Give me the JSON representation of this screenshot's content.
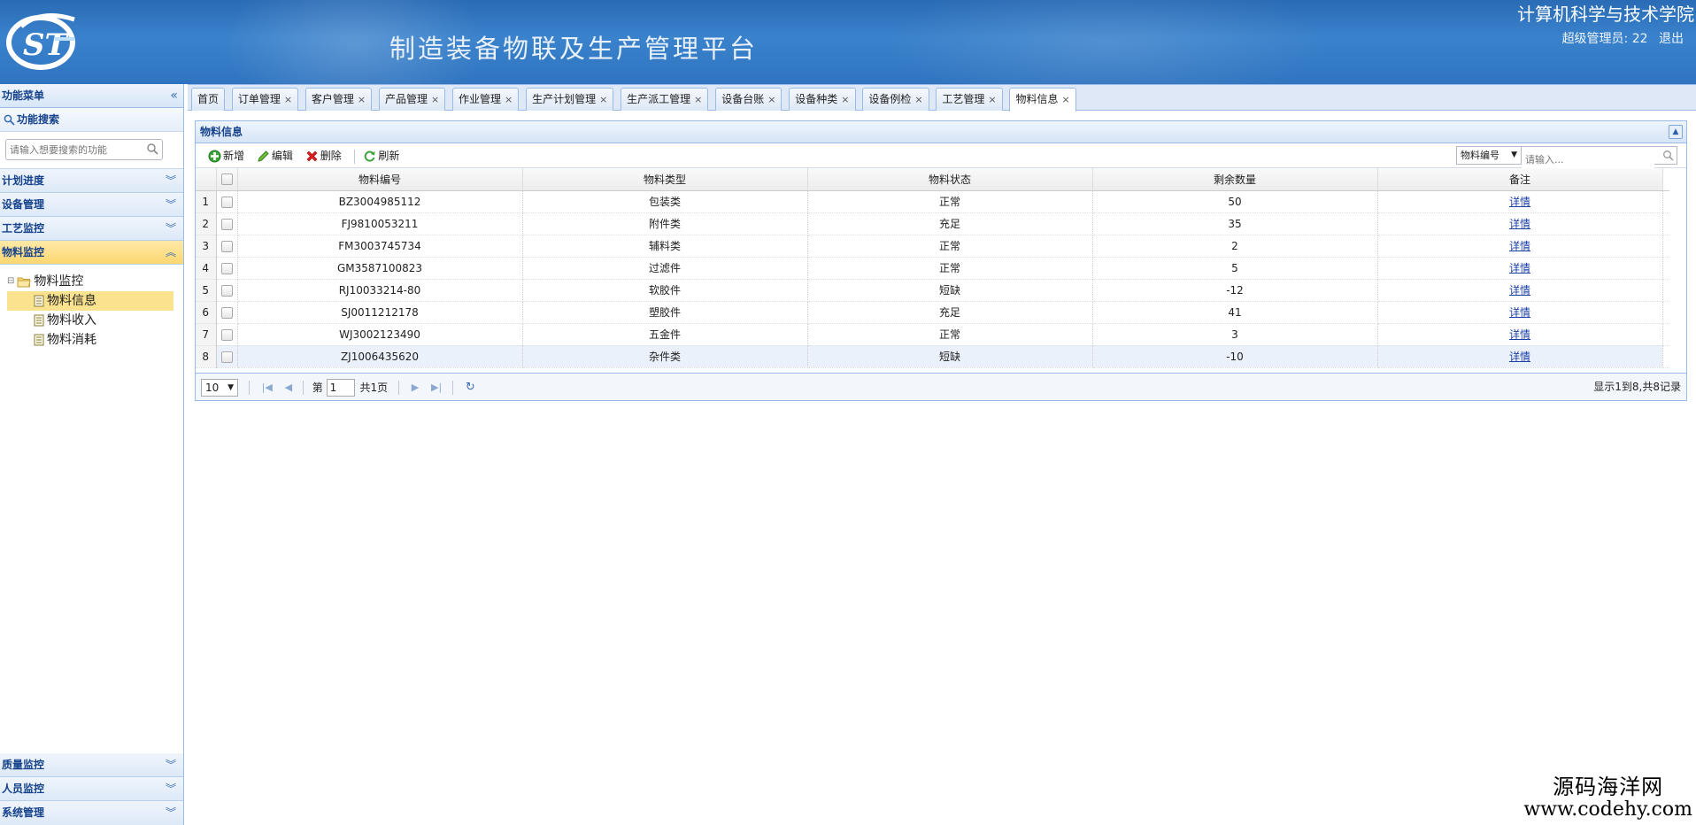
{
  "header": {
    "app_title": "制造装备物联及生产管理平台",
    "college": "计算机科学与技术学院",
    "user_label": "超级管理员: 22",
    "logout": "退出"
  },
  "sidebar": {
    "title": "功能菜单",
    "search_title": "功能搜索",
    "search_placeholder": "请输入想要搜索的功能",
    "sections": [
      "计划进度",
      "设备管理",
      "工艺监控",
      "物料监控"
    ],
    "tree": {
      "root": "物料监控",
      "children": [
        "物料信息",
        "物料收入",
        "物料消耗"
      ]
    },
    "bottom_sections": [
      "质量监控",
      "人员监控",
      "系统管理"
    ]
  },
  "tabs": [
    "首页",
    "订单管理",
    "客户管理",
    "产品管理",
    "作业管理",
    "生产计划管理",
    "生产派工管理",
    "设备台账",
    "设备种类",
    "设备例检",
    "工艺管理",
    "物料信息"
  ],
  "panel": {
    "title": "物料信息",
    "toolbar": {
      "add": "新增",
      "edit": "编辑",
      "delete": "删除",
      "refresh": "刷新"
    },
    "search_field": "物料编号",
    "search_placeholder": "请输入..."
  },
  "grid": {
    "columns": [
      "物料编号",
      "物料类型",
      "物料状态",
      "剩余数量",
      "备注"
    ],
    "rows": [
      {
        "n": "1",
        "code": "BZ3004985112",
        "type": "包装类",
        "status": "正常",
        "qty": "50",
        "note": "详情"
      },
      {
        "n": "2",
        "code": "FJ9810053211",
        "type": "附件类",
        "status": "充足",
        "qty": "35",
        "note": "详情"
      },
      {
        "n": "3",
        "code": "FM3003745734",
        "type": "辅料类",
        "status": "正常",
        "qty": "2",
        "note": "详情"
      },
      {
        "n": "4",
        "code": "GM3587100823",
        "type": "过滤件",
        "status": "正常",
        "qty": "5",
        "note": "详情"
      },
      {
        "n": "5",
        "code": "RJ10033214-80",
        "type": "软胶件",
        "status": "短缺",
        "qty": "-12",
        "note": "详情"
      },
      {
        "n": "6",
        "code": "SJ0011212178",
        "type": "塑胶件",
        "status": "充足",
        "qty": "41",
        "note": "详情"
      },
      {
        "n": "7",
        "code": "WJ3002123490",
        "type": "五金件",
        "status": "正常",
        "qty": "3",
        "note": "详情"
      },
      {
        "n": "8",
        "code": "ZJ1006435620",
        "type": "杂件类",
        "status": "短缺",
        "qty": "-10",
        "note": "详情"
      }
    ]
  },
  "pager": {
    "page_size": "10",
    "page_prefix": "第",
    "page_value": "1",
    "page_total": "共1页",
    "info": "显示1到8,共8记录"
  },
  "watermark": {
    "cn": "源码海洋网",
    "en": "www.codehy.com"
  }
}
